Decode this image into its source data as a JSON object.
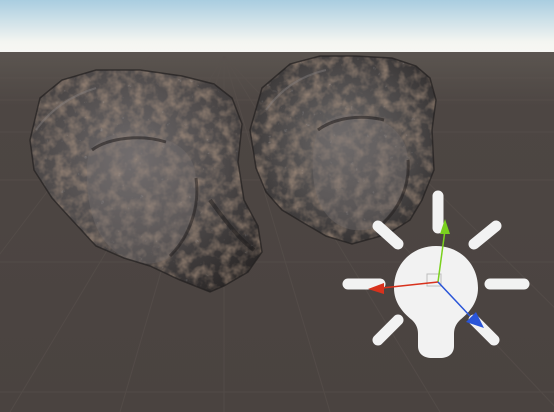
{
  "scene_view": {
    "colors": {
      "sky_top": "#a9cde0",
      "sky_horizon": "#f4f5f1",
      "ground": "#4a4340",
      "grid_line": "#5a524e",
      "rock_base": "#5b5958",
      "rock_dark": "#2f2c2c",
      "rock_rust": "#6b4a36",
      "light_gizmo": "#f2f2f2",
      "axis_x": "#d8321d",
      "axis_y": "#7ad11e",
      "axis_z": "#2a55d8"
    },
    "objects": [
      {
        "kind": "rock",
        "name": "left-rock",
        "selected": false
      },
      {
        "kind": "rock",
        "name": "right-rock",
        "selected": false
      }
    ],
    "gizmos": [
      {
        "icon": "light-bulb-icon",
        "type": "point-light"
      },
      {
        "icon": "move-tool-icon",
        "axes": [
          "x",
          "y",
          "z"
        ]
      }
    ]
  }
}
